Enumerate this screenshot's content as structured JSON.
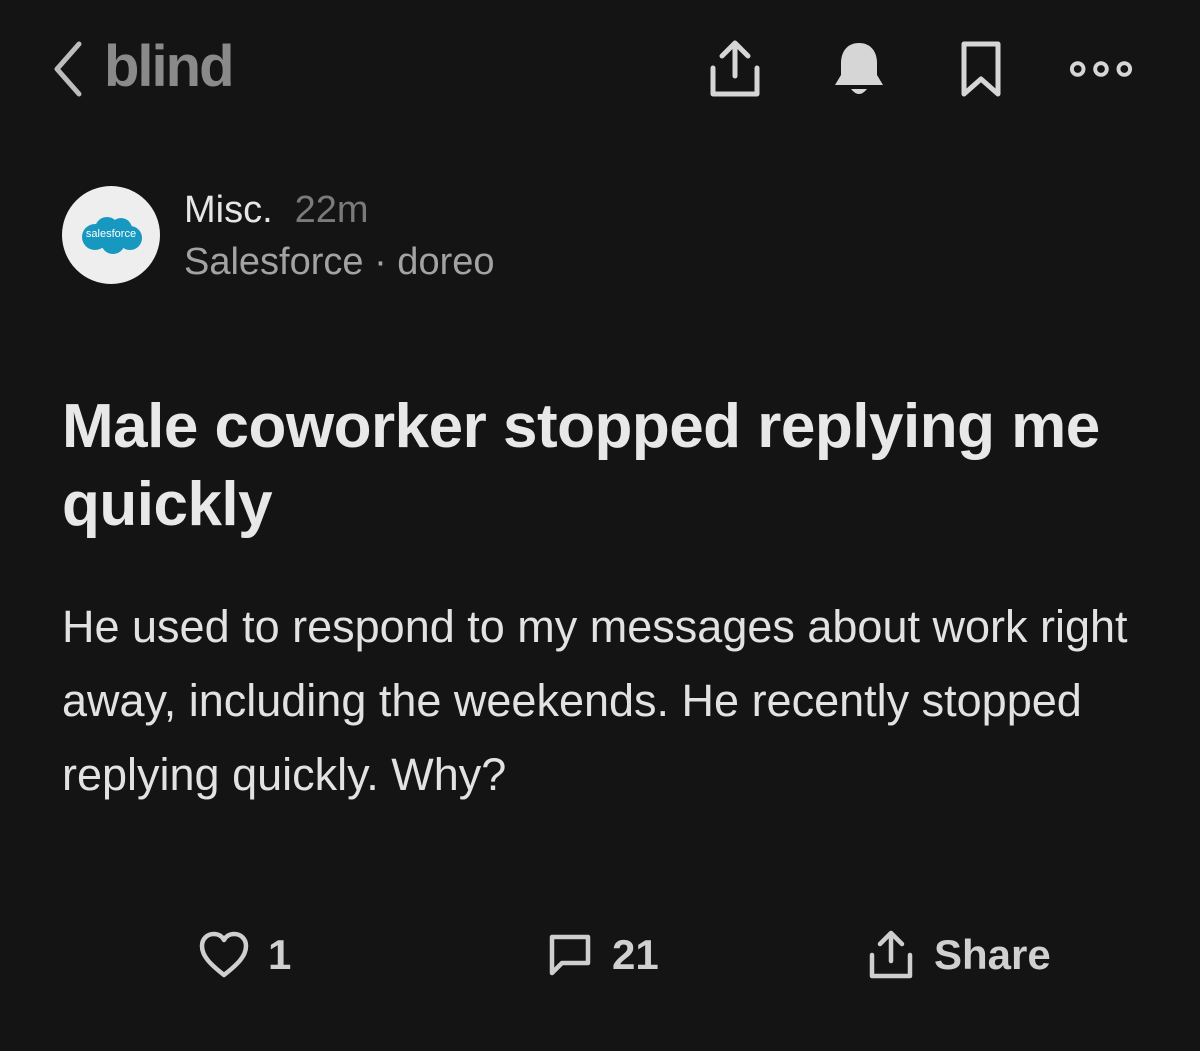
{
  "app": {
    "brand": "blind"
  },
  "header_icons": [
    "chevron-left-icon",
    "share-icon",
    "bell-icon",
    "bookmark-icon",
    "more-icon"
  ],
  "post": {
    "channel": "Misc.",
    "time_ago": "22m",
    "company_user": "Salesforce · doreo",
    "avatar_logo_text": "salesforce",
    "title": "Male coworker stopped replying me quickly",
    "body": "He used to respond to my messages about work right away, including the weekends. He recently stopped replying quickly. Why?"
  },
  "actions": {
    "likes": "1",
    "comments": "21",
    "share_label": "Share"
  },
  "colors": {
    "background": "#141414",
    "salesforce_blue": "#1798c1"
  }
}
